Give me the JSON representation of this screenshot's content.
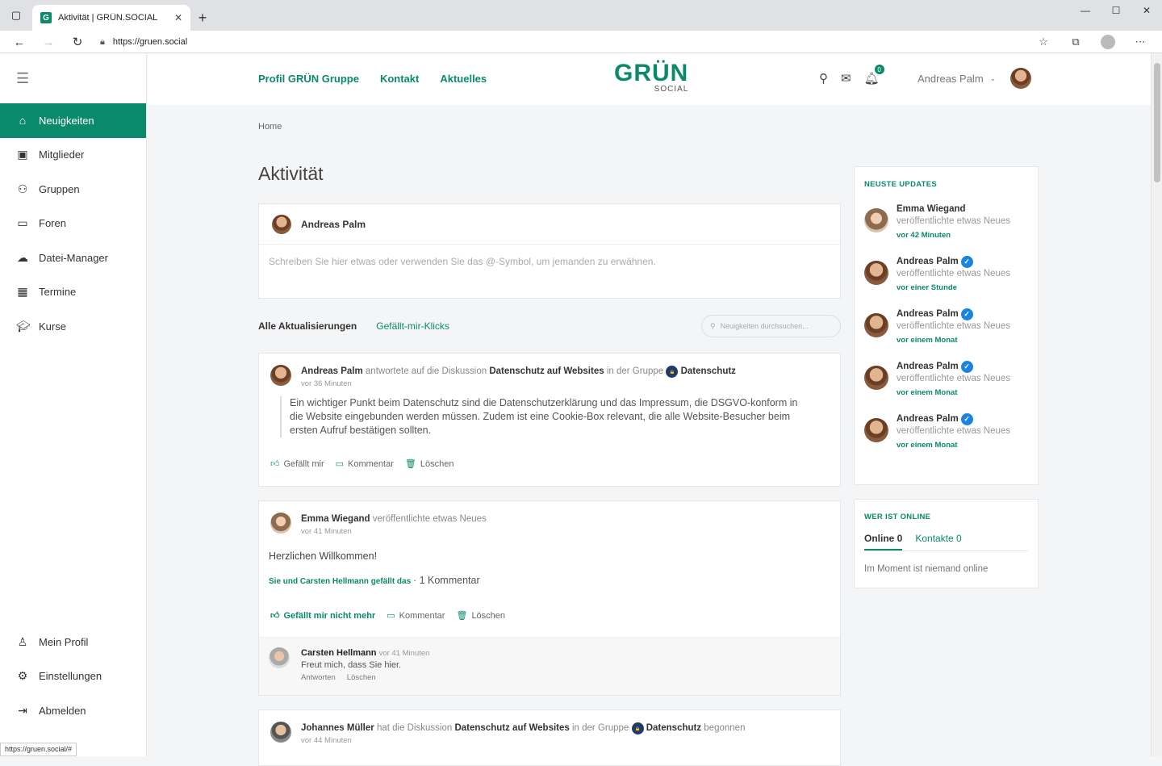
{
  "browser": {
    "tab_title": "Aktivität | GRÜN.SOCIAL",
    "tab_favicon": "G",
    "url": "https://gruen.social",
    "status_url": "https://gruen.social/#"
  },
  "sidebar": {
    "items": [
      {
        "label": "Neuigkeiten",
        "icon": "home-icon",
        "active": true
      },
      {
        "label": "Mitglieder",
        "icon": "contact-card-icon"
      },
      {
        "label": "Gruppen",
        "icon": "users-icon"
      },
      {
        "label": "Foren",
        "icon": "chat-icon"
      },
      {
        "label": "Datei-Manager",
        "icon": "cloud-upload-icon"
      },
      {
        "label": "Termine",
        "icon": "calendar-icon"
      },
      {
        "label": "Kurse",
        "icon": "graduation-cap-icon"
      }
    ],
    "bottom": [
      {
        "label": "Mein Profil",
        "icon": "user-icon"
      },
      {
        "label": "Einstellungen",
        "icon": "gear-icon"
      },
      {
        "label": "Abmelden",
        "icon": "logout-icon"
      }
    ]
  },
  "topnav": {
    "links": [
      "Profil GRÜN Gruppe",
      "Kontakt",
      "Aktuelles"
    ],
    "logo_main": "GRÜN",
    "logo_sub": "SOCIAL",
    "notification_count": "0",
    "user_name": "Andreas Palm"
  },
  "main": {
    "breadcrumb": "Home",
    "title": "Aktivität",
    "composer": {
      "user": "Andreas Palm",
      "placeholder": "Schreiben Sie hier etwas oder verwenden Sie das @-Symbol, um jemanden zu erwähnen."
    },
    "filters": {
      "all": "Alle Aktualisierungen",
      "likes": "Gefällt-mir-Klicks",
      "search_placeholder": "Neuigkeiten durchsuchen..."
    },
    "posts": [
      {
        "author": "Andreas Palm",
        "action": "antwortete auf die Diskussion",
        "topic": "Datenschutz auf Websites",
        "in_group": "in der Gruppe",
        "group": "Datenschutz",
        "time": "vor 36 Minuten",
        "quote": "Ein wichtiger Punkt beim Datenschutz sind die Datenschutzerklärung und das Impressum, die DSGVO-konform in die Website eingebunden werden müssen. Zudem ist eine Cookie-Box relevant, die alle Website-Besucher beim ersten Aufruf bestätigen sollten.",
        "like": "Gefällt mir",
        "comment": "Kommentar",
        "delete": "Löschen"
      },
      {
        "author": "Emma Wiegand",
        "action": "veröffentlichte etwas Neues",
        "time": "vor 41 Minuten",
        "text": "Herzlichen Willkommen!",
        "likes_text": "Sie und Carsten Hellmann gefällt das",
        "comments_count": "1 Kommentar",
        "like": "Gefällt mir nicht mehr",
        "comment": "Kommentar",
        "delete": "Löschen",
        "reply": {
          "author": "Carsten Hellmann",
          "time": "vor 41 Minuten",
          "text": "Freut mich, dass Sie hier.",
          "answer": "Antworten",
          "delete": "Löschen"
        }
      },
      {
        "author": "Johannes Müller",
        "action": "hat die Diskussion",
        "topic": "Datenschutz auf Websites",
        "in_group": "in der Gruppe",
        "group": "Datenschutz",
        "suffix": "begonnen",
        "time": "vor 44 Minuten"
      }
    ]
  },
  "widgets": {
    "updates_title": "NEUSTE UPDATES",
    "updates": [
      {
        "name": "Emma Wiegand",
        "action": "veröffentlichte etwas Neues",
        "time": "vor 42 Minuten",
        "verified": false
      },
      {
        "name": "Andreas Palm",
        "action": "veröffentlichte etwas Neues",
        "time": "vor einer Stunde",
        "verified": true
      },
      {
        "name": "Andreas Palm",
        "action": "veröffentlichte etwas Neues",
        "time": "vor einem Monat",
        "verified": true
      },
      {
        "name": "Andreas Palm",
        "action": "veröffentlichte etwas Neues",
        "time": "vor einem Monat",
        "verified": true
      },
      {
        "name": "Andreas Palm",
        "action": "veröffentlichte etwas Neues",
        "time": "vor einem Monat",
        "verified": true
      }
    ],
    "online_title": "WER IST ONLINE",
    "online_tab": "Online 0",
    "contacts_tab": "Kontakte 0",
    "online_msg": "Im Moment ist niemand online"
  },
  "colors": {
    "accent": "#0a8a6b",
    "verified": "#1a85e0"
  }
}
